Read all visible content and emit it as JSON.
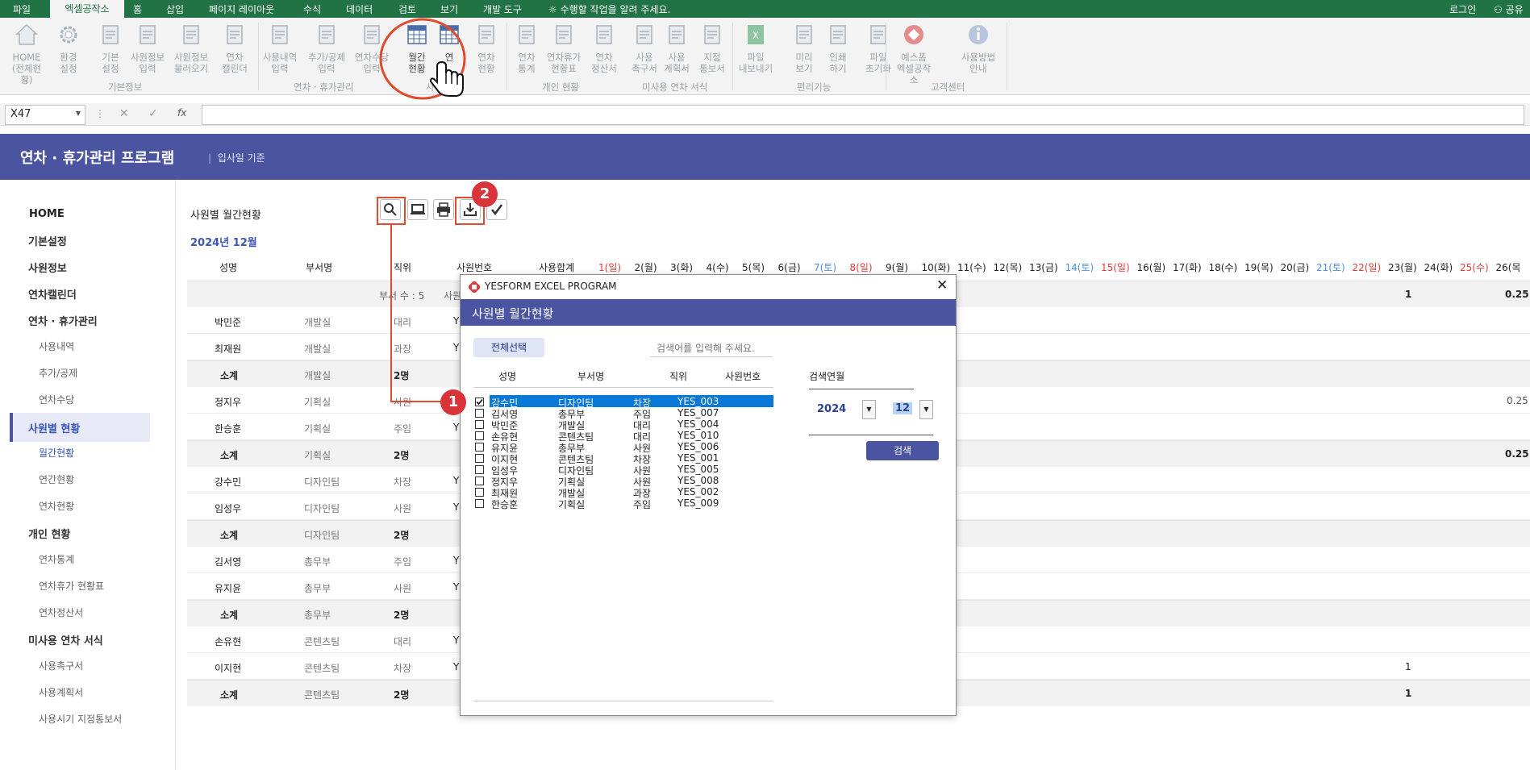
{
  "menubar": {
    "items": [
      "파일",
      "엑셀공작소",
      "홈",
      "삽입",
      "페이지 레이아웃",
      "수식",
      "데이터",
      "검토",
      "보기",
      "개발 도구"
    ],
    "tell_me": "수행할 작업을 알려 주세요.",
    "login": "로그인",
    "share": "공유"
  },
  "ribbon": {
    "buttons": [
      {
        "label": "HOME\n(전체현황)",
        "icon": "home-icon"
      },
      {
        "label": "환경\n설정",
        "icon": "gear-icon"
      },
      {
        "label": "기본\n설정",
        "icon": "settings-doc-icon"
      },
      {
        "label": "사원정보\n입력",
        "icon": "users-icon"
      },
      {
        "label": "사원정보\n불러오기",
        "icon": "user-import-icon"
      },
      {
        "label": "연차\n캘린더",
        "icon": "calendar-icon"
      },
      {
        "label": "사용내역\n입력",
        "icon": "edit-doc-icon"
      },
      {
        "label": "추가/공제\n입력",
        "icon": "edit-doc-icon"
      },
      {
        "label": "연차수당\n입력",
        "icon": "edit-doc-icon"
      },
      {
        "label": "월간\n현황",
        "icon": "table-icon"
      },
      {
        "label": "연\n",
        "icon": "table-icon"
      },
      {
        "label": "연차\n현황",
        "icon": "users-table-icon"
      },
      {
        "label": "연차\n통계",
        "icon": "chart-icon"
      },
      {
        "label": "연차휴가\n현황표",
        "icon": "checklist-icon"
      },
      {
        "label": "연차\n정산서",
        "icon": "id-card-icon"
      },
      {
        "label": "사용\n촉구서",
        "icon": "edit-doc-icon"
      },
      {
        "label": "사용\n계획서",
        "icon": "edit-doc-icon"
      },
      {
        "label": "지정\n통보서",
        "icon": "edit-doc-icon"
      },
      {
        "label": "파일\n내보내기",
        "icon": "excel-icon"
      },
      {
        "label": "미리\n보기",
        "icon": "preview-icon"
      },
      {
        "label": "인쇄\n하기",
        "icon": "printer-icon"
      },
      {
        "label": "파일\n초기화",
        "icon": "trash-icon"
      },
      {
        "label": "예스폼\n엑셀공작소",
        "icon": "yesform-icon"
      },
      {
        "label": "사용방법\n안내",
        "icon": "info-icon"
      }
    ],
    "groups": [
      "기본정보",
      "연차 · 휴가관리",
      "사",
      "개인 현황",
      "미사용 연차 서식",
      "편리기능",
      "고객센터"
    ]
  },
  "formula": {
    "name_box": "X47",
    "fx": "fx"
  },
  "banner": {
    "title": "연차 · 휴가관리 프로그램",
    "subtitle": "입사일 기준"
  },
  "sidebar": {
    "home": "HOME",
    "items": [
      "기본설정",
      "사원정보",
      "연차캘린더",
      "연차 · 휴가관리",
      "사용내역",
      "추가/공제",
      "연차수당",
      "사원별 현황",
      "월간현황",
      "연간현황",
      "연차현황",
      "개인 현황",
      "연차통계",
      "연차휴가 현황표",
      "연차정산서",
      "미사용 연차 서식",
      "사용촉구서",
      "사용계획서",
      "사용시기 지정통보서"
    ]
  },
  "sheet": {
    "title": "사원별 월간현황",
    "period": "2024년 12월",
    "headers": [
      "성명",
      "부서명",
      "직위",
      "사원번호",
      "사용합계"
    ],
    "days": [
      "1(일)",
      "2(월)",
      "3(화)",
      "4(수)",
      "5(목)",
      "6(금)",
      "7(토)",
      "8(일)",
      "9(월)",
      "10(화)",
      "11(수)",
      "12(목)",
      "13(금)",
      "14(토)",
      "15(일)",
      "16(월)",
      "17(화)",
      "18(수)",
      "19(목)",
      "20(금)",
      "21(토)",
      "22(일)",
      "23(월)",
      "24(화)",
      "25(수)",
      "26(목"
    ],
    "summary": {
      "dept_count": "부서 수 : 5",
      "partial": "사원",
      "total_1": "1",
      "total_2": "0.25"
    },
    "rows": [
      {
        "name": "박민준",
        "dept": "개발실",
        "pos": "대리",
        "id": "Y",
        "subtotal": false
      },
      {
        "name": "최재원",
        "dept": "개발실",
        "pos": "과장",
        "id": "Y",
        "subtotal": false
      },
      {
        "name": "소계",
        "dept": "개발실",
        "pos": "2명",
        "id": "",
        "subtotal": true
      },
      {
        "name": "정지우",
        "dept": "기획실",
        "pos": "사원",
        "id": "",
        "subtotal": false
      },
      {
        "name": "한승훈",
        "dept": "기획실",
        "pos": "주임",
        "id": "Y",
        "subtotal": false
      },
      {
        "name": "소계",
        "dept": "기획실",
        "pos": "2명",
        "id": "",
        "subtotal": true
      },
      {
        "name": "강수민",
        "dept": "디자인팀",
        "pos": "차장",
        "id": "Y",
        "subtotal": false
      },
      {
        "name": "임성우",
        "dept": "디자인팀",
        "pos": "사원",
        "id": "Y",
        "subtotal": false
      },
      {
        "name": "소계",
        "dept": "디자인팀",
        "pos": "2명",
        "id": "",
        "subtotal": true
      },
      {
        "name": "김서영",
        "dept": "총무부",
        "pos": "주임",
        "id": "Y",
        "subtotal": false
      },
      {
        "name": "유지윤",
        "dept": "총무부",
        "pos": "사원",
        "id": "Y",
        "subtotal": false
      },
      {
        "name": "소계",
        "dept": "총무부",
        "pos": "2명",
        "id": "",
        "subtotal": true
      },
      {
        "name": "손유현",
        "dept": "콘텐츠팀",
        "pos": "대리",
        "id": "Y",
        "subtotal": false
      },
      {
        "name": "이지현",
        "dept": "콘텐츠팀",
        "pos": "차장",
        "id": "Y",
        "subtotal": false
      },
      {
        "name": "소계",
        "dept": "콘텐츠팀",
        "pos": "2명",
        "id": "",
        "subtotal": true
      }
    ],
    "right_values": {
      "jiwoo": "0.25",
      "giheok_total": "0.25",
      "jihyun": "1",
      "content_total": "1"
    }
  },
  "dialog": {
    "app_title": "YESFORM EXCEL PROGRAM",
    "heading": "사원별 월간현황",
    "select_all": "전체선택",
    "search_placeholder": "검색어를 입력해 주세요.",
    "columns": [
      "성명",
      "부서명",
      "직위",
      "사원번호"
    ],
    "employees": [
      {
        "name": "강수민",
        "dept": "디자인팀",
        "pos": "차장",
        "id": "YES_003",
        "checked": true
      },
      {
        "name": "김서영",
        "dept": "총무부",
        "pos": "주임",
        "id": "YES_007",
        "checked": false
      },
      {
        "name": "박민준",
        "dept": "개발실",
        "pos": "대리",
        "id": "YES_004",
        "checked": false
      },
      {
        "name": "손유현",
        "dept": "콘텐츠팀",
        "pos": "대리",
        "id": "YES_010",
        "checked": false
      },
      {
        "name": "유지윤",
        "dept": "총무부",
        "pos": "사원",
        "id": "YES_006",
        "checked": false
      },
      {
        "name": "이지현",
        "dept": "콘텐츠팀",
        "pos": "차장",
        "id": "YES_001",
        "checked": false
      },
      {
        "name": "임성우",
        "dept": "디자인팀",
        "pos": "사원",
        "id": "YES_005",
        "checked": false
      },
      {
        "name": "정지우",
        "dept": "기획실",
        "pos": "사원",
        "id": "YES_008",
        "checked": false
      },
      {
        "name": "최재원",
        "dept": "개발실",
        "pos": "과장",
        "id": "YES_002",
        "checked": false
      },
      {
        "name": "한승훈",
        "dept": "기획실",
        "pos": "주임",
        "id": "YES_009",
        "checked": false
      }
    ],
    "period_label": "검색연월",
    "year": "2024",
    "month": "12",
    "search_button": "검색"
  },
  "annotations": {
    "step1": "1",
    "step2": "2"
  },
  "colors": {
    "excel_green": "#217346",
    "accent": "#4b54a1",
    "highlight": "#e14b2d",
    "selection": "#0a78d7"
  }
}
